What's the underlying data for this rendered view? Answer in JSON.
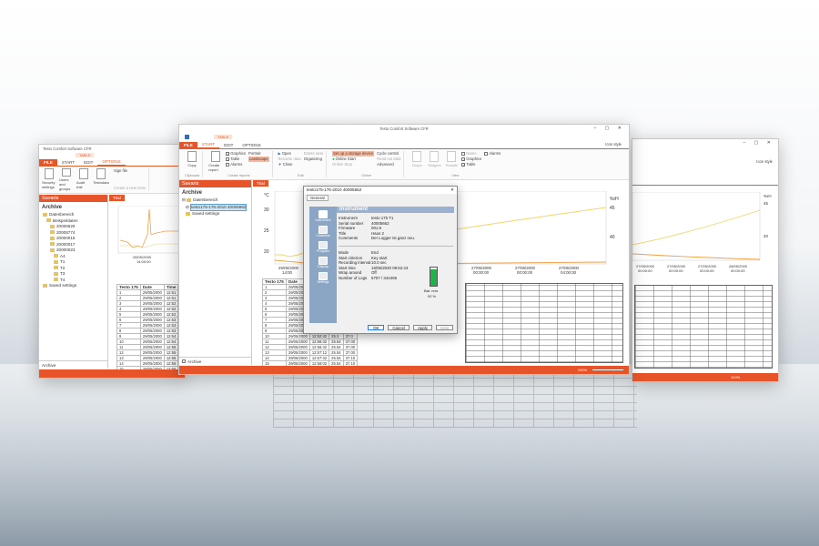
{
  "left_window": {
    "title": "Testo Comfort Software CFR",
    "context_tab": "TABLE",
    "tabs": [
      "FILE",
      "START",
      "EDIT",
      "OPTIONS"
    ],
    "ribbon": {
      "items": [
        "Security settings",
        "Users and groups",
        "Audit trail",
        "Testodata"
      ],
      "small": [
        "Sign file",
        "Create a new testo"
      ]
    },
    "sidebar_head": "Savaris",
    "sidebar_title": "Archive",
    "tree": [
      "Datenbereich",
      "Beispieldaten",
      "20006626",
      "20008774",
      "20000015",
      "20000017",
      "20000023",
      "A4",
      "T1",
      "T2",
      "T3",
      "T4",
      "Saved settings"
    ],
    "footer": "Archive",
    "trial_tab": "Trial",
    "table_headers": [
      "Testo 175",
      "Date",
      "Time"
    ],
    "dates": [
      "29/05/2000",
      "29/05/2000",
      "29/05/2000",
      "29/05/2000",
      "29/05/2000",
      "29/05/2000",
      "29/05/2000",
      "29/05/2000",
      "29/05/2000",
      "29/05/2000",
      "29/05/2000",
      "29/05/2000",
      "29/05/2000",
      "29/05/2000",
      "29/05/2000"
    ],
    "times": [
      "12:51",
      "12:51",
      "12:52",
      "12:52",
      "12:52",
      "12:53",
      "12:53",
      "12:53",
      "12:54",
      "12:54",
      "12:55",
      "12:55",
      "12:55",
      "12:56",
      "12:56"
    ],
    "chart_date": "28/05/2000",
    "chart_time": "14:00:00"
  },
  "center_window": {
    "title": "Testo Comfort Software CFR",
    "context_tab": "TABLE",
    "tabs": [
      "FILE",
      "START",
      "EDIT",
      "OPTIONS"
    ],
    "account": "Icon style",
    "ribbon": {
      "clipboard": {
        "copy": "Copy",
        "name": "Clipboard"
      },
      "reports": {
        "create": "Create report",
        "graphics": "Graphics",
        "table": "Table",
        "alarms": "Alarms",
        "portrait": "Portrait",
        "landscape": "Landscape",
        "name": "Create reports"
      },
      "edit": {
        "open": "Open",
        "rename": "Rename data",
        "close": "Close",
        "delete": "Delete data",
        "organizing": "Organizing",
        "name": "Edit"
      },
      "online": {
        "setup": "Set up a storage device",
        "start": "Online Start",
        "stop": "Online Stop",
        "cycle": "Cycle control",
        "read": "Read out data",
        "advanced": "Advanced",
        "name": "Online"
      },
      "view": {
        "graph": "Graph",
        "widgets": "Widgets",
        "series": "Results",
        "name_item": "Name",
        "graphics": "Graphics",
        "table": "Table",
        "alarms": "Alarms",
        "name": "View"
      }
    },
    "sidebar_head": "Savaris",
    "sidebar_title": "Archive",
    "tree": [
      "Datenbereich",
      "testo175-176-2010 40005662",
      "Saved settings"
    ],
    "footer": "Archive",
    "trial_tab": "Trial",
    "chart": {
      "y_unit": "°C",
      "y_ticks": [
        "30",
        "25",
        "20"
      ],
      "y2_unit": "%rH",
      "y2_ticks": [
        "45",
        "40"
      ],
      "x_labels": [
        {
          "d": "26/05/2000",
          "t": "14:00"
        },
        {
          "d": "27/05/2000",
          "t": "00:00:00"
        },
        {
          "d": "27/05/2000",
          "t": "00:00:00"
        },
        {
          "d": "27/05/2000",
          "t": "04:00:00"
        }
      ]
    },
    "table_headers": [
      "Testo 175",
      "Date",
      "Time",
      "°C",
      "%rH"
    ],
    "rows": [
      {
        "n": "1",
        "d": "29/05/2000",
        "t": "12:51:02",
        "c": "25.0",
        "h": "37.1"
      },
      {
        "n": "2",
        "d": "29/05/2000",
        "t": "12:51:12",
        "c": "25.0",
        "h": "37.1"
      },
      {
        "n": "3",
        "d": "29/05/2000",
        "t": "12:51:22",
        "c": "25.1",
        "h": "37.1"
      },
      {
        "n": "4",
        "d": "29/05/2000",
        "t": "12:51:32",
        "c": "25.1",
        "h": "37.0"
      },
      {
        "n": "5",
        "d": "29/05/2000",
        "t": "12:51:42",
        "c": "25.1",
        "h": "37.0"
      },
      {
        "n": "6",
        "d": "29/05/2000",
        "t": "12:52:02",
        "c": "25.2",
        "h": "37.0"
      },
      {
        "n": "7",
        "d": "29/05/2000",
        "t": "12:52:12",
        "c": "25.2",
        "h": "37.0"
      },
      {
        "n": "8",
        "d": "29/05/2000",
        "t": "12:52:22",
        "c": "25.2",
        "h": "37.0"
      },
      {
        "n": "9",
        "d": "29/05/2000",
        "t": "12:52:32",
        "c": "25.3",
        "h": "37.0"
      },
      {
        "n": "10",
        "d": "29/05/2000",
        "t": "12:52:42",
        "c": "25.3",
        "h": "37.0"
      },
      {
        "n": "11",
        "d": "29/05/2000",
        "t": "12:56:32",
        "c": "25.54",
        "h": "37.00"
      },
      {
        "n": "12",
        "d": "29/05/2000",
        "t": "12:56:42",
        "c": "25.54",
        "h": "37.00"
      },
      {
        "n": "13",
        "d": "29/05/2000",
        "t": "12:57:12",
        "c": "25.54",
        "h": "37.00"
      },
      {
        "n": "14",
        "d": "29/05/2000",
        "t": "12:57:42",
        "c": "25.54",
        "h": "37.10"
      },
      {
        "n": "15",
        "d": "29/05/2000",
        "t": "12:58:02",
        "c": "25.54",
        "h": "37.10"
      },
      {
        "n": "16",
        "d": "29/05/2000",
        "t": "12:58:22",
        "c": "25.54",
        "h": "37.10"
      },
      {
        "n": "17",
        "d": "29/05/2000",
        "t": "12:58:42",
        "c": "25.54",
        "h": "37.10"
      }
    ],
    "zoom": "100%"
  },
  "right_window": {
    "account": "Icon style",
    "chart": {
      "y2_unit": "%rH",
      "y2_ticks": [
        "45",
        "40"
      ],
      "x_labels": [
        {
          "d": "27/05/2000",
          "t": "00:00:00"
        },
        {
          "d": "27/05/2000",
          "t": "00:00:00"
        },
        {
          "d": "27/05/2000",
          "t": "00:00:00"
        },
        {
          "d": "28/05/2000",
          "t": "00:00:00"
        }
      ]
    },
    "zoom": "100%"
  },
  "dialog": {
    "title": "testo175-176-2010 40005662",
    "tab": "General",
    "header": "Instrument",
    "side_items": [
      "Instrument",
      "Channels",
      "Program",
      "Display",
      "Settings"
    ],
    "fields1": [
      {
        "k": "Instrument",
        "v": "testo 175 T1"
      },
      {
        "k": "Serial number",
        "v": "40005662"
      },
      {
        "k": "Firmware",
        "v": "001.9"
      },
      {
        "k": "Title",
        "v": "Haus 2"
      },
      {
        "k": "Comments",
        "v": "Der Logger ist ganz neu."
      }
    ],
    "fields2": [
      {
        "k": "Mode",
        "v": "End"
      },
      {
        "k": "Start criterion",
        "v": "Key start"
      },
      {
        "k": "Recording interval",
        "v": "10.0 sec"
      },
      {
        "k": "Start time",
        "v": "16/05/2020 09:52:43"
      },
      {
        "k": "Wrap around",
        "v": "Off"
      },
      {
        "k": "Number of Logs",
        "v": "5707 / 344465"
      }
    ],
    "battery_label": "Bat. rem.",
    "battery_percent": 92,
    "battery_text": "92 %",
    "buttons": [
      "OK",
      "Cancel",
      "Apply",
      "Help"
    ]
  }
}
